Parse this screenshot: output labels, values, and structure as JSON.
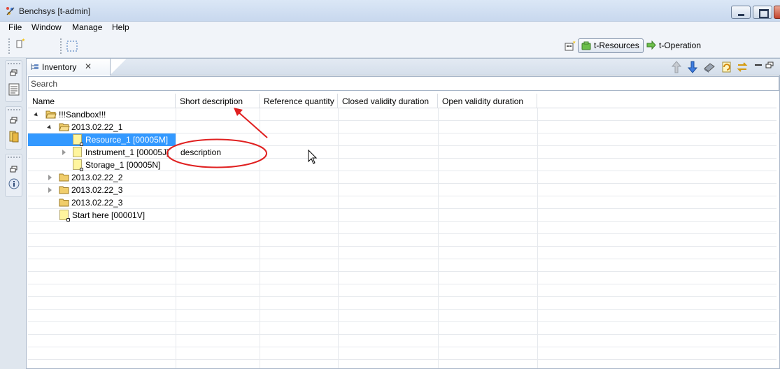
{
  "window": {
    "title": "Benchsys [t-admin]"
  },
  "menu": [
    "File",
    "Window",
    "Manage",
    "Help"
  ],
  "perspectives": {
    "active": "t-Resources",
    "other": "t-Operation"
  },
  "view": {
    "tab_label": "Inventory",
    "tab_close": "✕",
    "search_placeholder": "Search"
  },
  "table": {
    "columns": [
      "Name",
      "Short description",
      "Reference quantity",
      "Closed validity duration",
      "Open validity duration"
    ],
    "rows": [
      {
        "name": "!!!Sandbox!!!",
        "description": ""
      },
      {
        "name": "2013.02.22_1",
        "description": ""
      },
      {
        "name": "Resource_1 [00005M]",
        "description": ""
      },
      {
        "name": "Instrument_1 [00005J]",
        "description": "description"
      },
      {
        "name": "Storage_1 [00005N]",
        "description": ""
      },
      {
        "name": "2013.02.22_2",
        "description": ""
      },
      {
        "name": "2013.02.22_3",
        "description": ""
      },
      {
        "name": "2013.02.22_3",
        "description": ""
      },
      {
        "name": "Start here [00001V]",
        "description": ""
      }
    ]
  },
  "colors": {
    "selection": "#3399ff",
    "annotation": "#e02020"
  },
  "icons": {
    "app": "benchsys-logo-icon",
    "new": "new-item-icon",
    "select": "marquee-select-icon",
    "perspective": "open-perspective-icon"
  }
}
